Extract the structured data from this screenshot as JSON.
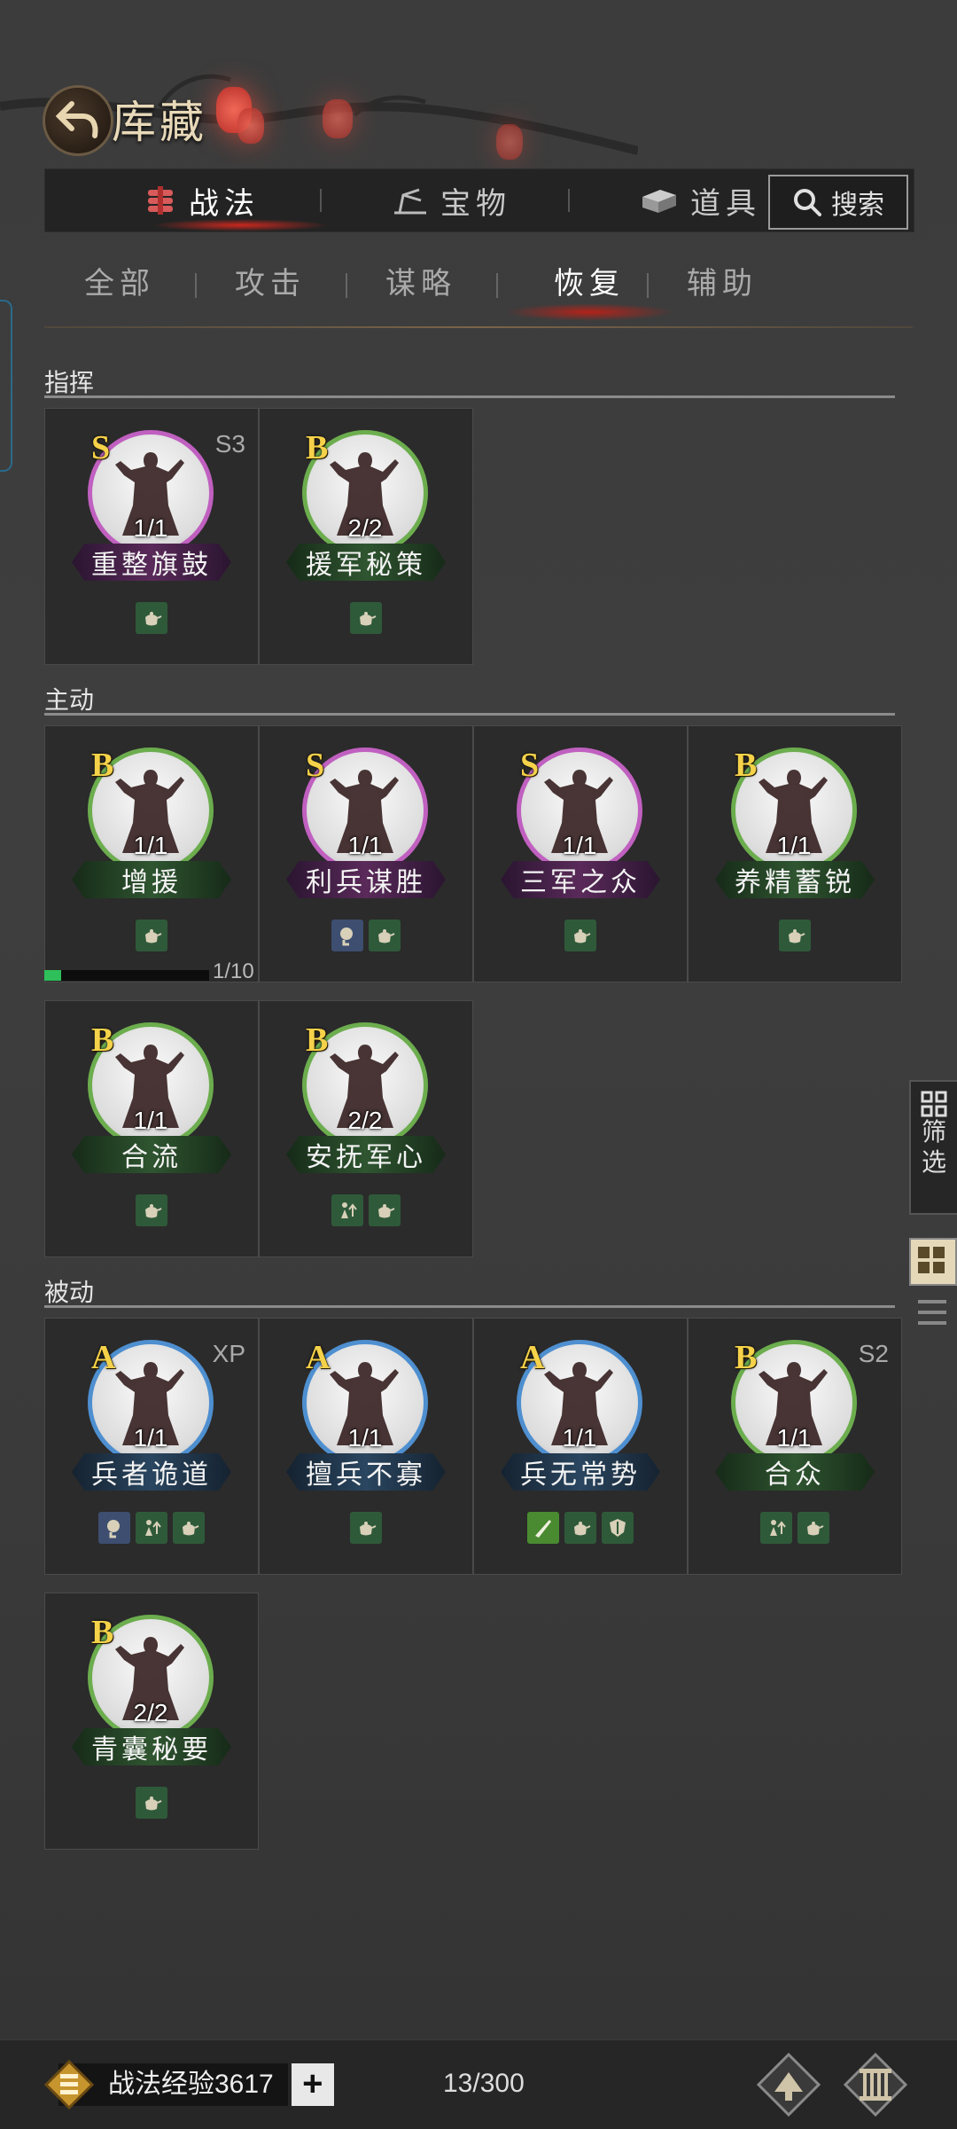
{
  "header": {
    "title": "库藏"
  },
  "main_tabs": [
    {
      "label": "战法",
      "icon": "scroll-bundle-icon",
      "active": true
    },
    {
      "label": "宝物",
      "icon": "treasure-icon",
      "active": false
    },
    {
      "label": "道具",
      "icon": "item-box-icon",
      "active": false
    }
  ],
  "search": {
    "label": "搜索"
  },
  "sub_tabs": [
    {
      "label": "全部",
      "active": false
    },
    {
      "label": "攻击",
      "active": false
    },
    {
      "label": "谋略",
      "active": false
    },
    {
      "label": "恢复",
      "active": true
    },
    {
      "label": "辅助",
      "active": false
    }
  ],
  "sections": [
    {
      "title": "指挥"
    },
    {
      "title": "主动"
    },
    {
      "title": "被动"
    }
  ],
  "cards": [
    {
      "name": "重整旗鼓",
      "grade": "S",
      "count": "1/1",
      "tag": "S3",
      "icons": [
        "teapot-icon"
      ]
    },
    {
      "name": "援军秘策",
      "grade": "B",
      "count": "2/2",
      "tag": "",
      "icons": [
        "teapot-icon"
      ]
    },
    {
      "name": "增援",
      "grade": "B",
      "count": "1/1",
      "tag": "",
      "icons": [
        "teapot-icon"
      ]
    },
    {
      "name": "利兵谋胜",
      "grade": "S",
      "count": "1/1",
      "tag": "",
      "icons": [
        "mind-icon",
        "teapot-icon"
      ]
    },
    {
      "name": "三军之众",
      "grade": "S",
      "count": "1/1",
      "tag": "",
      "icons": [
        "teapot-icon"
      ]
    },
    {
      "name": "养精蓄锐",
      "grade": "B",
      "count": "1/1",
      "tag": "",
      "icons": [
        "teapot-icon"
      ]
    },
    {
      "name": "合流",
      "grade": "B",
      "count": "1/1",
      "tag": "",
      "icons": [
        "teapot-icon"
      ]
    },
    {
      "name": "安抚军心",
      "grade": "B",
      "count": "2/2",
      "tag": "",
      "icons": [
        "buff-up-icon",
        "teapot-icon"
      ]
    },
    {
      "name": "兵者诡道",
      "grade": "A",
      "count": "1/1",
      "tag": "XP",
      "icons": [
        "mind-icon",
        "buff-up-icon",
        "teapot-icon"
      ]
    },
    {
      "name": "擅兵不寡",
      "grade": "A",
      "count": "1/1",
      "tag": "",
      "icons": [
        "teapot-icon"
      ]
    },
    {
      "name": "兵无常势",
      "grade": "A",
      "count": "1/1",
      "tag": "",
      "icons": [
        "blade-icon",
        "teapot-icon",
        "shield-icon"
      ]
    },
    {
      "name": "合众",
      "grade": "B",
      "count": "1/1",
      "tag": "S2",
      "icons": [
        "buff-up-icon",
        "teapot-icon"
      ]
    },
    {
      "name": "青囊秘要",
      "grade": "B",
      "count": "2/2",
      "tag": "",
      "icons": [
        "teapot-icon"
      ]
    }
  ],
  "progress": {
    "text": "1/10",
    "fraction": 0.1
  },
  "side_filter": {
    "label_line1": "筛",
    "label_line2": "选"
  },
  "footer": {
    "exp_label": "战法经验3617",
    "plus": "+",
    "capacity": "13/300"
  },
  "colors": {
    "grade_S": "#c060c0",
    "grade_A": "#4e8fd0",
    "grade_B": "#6cad4e",
    "grade_letter": "#f5d24a",
    "active_glow": "#dc281e"
  }
}
